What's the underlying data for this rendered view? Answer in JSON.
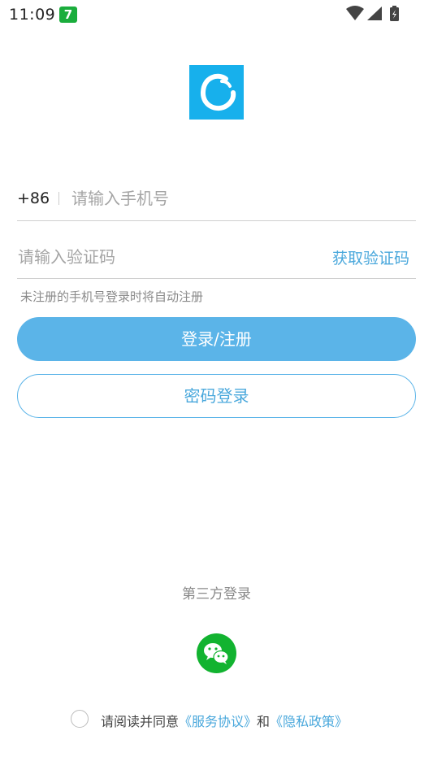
{
  "status_bar": {
    "time": "11:09",
    "notification_badge": "7",
    "icons": [
      "wifi-icon",
      "signal-icon",
      "battery-icon"
    ]
  },
  "logo": {
    "icon": "app-logo-icon",
    "color": "#17b0ec"
  },
  "phone": {
    "country_code": "+86",
    "placeholder": "请输入手机号"
  },
  "code": {
    "placeholder": "请输入验证码",
    "get_code_label": "获取验证码"
  },
  "hint": "未注册的手机号登录时将自动注册",
  "buttons": {
    "login_register": "登录/注册",
    "password_login": "密码登录"
  },
  "third_party": {
    "title": "第三方登录",
    "wechat_icon": "wechat-icon",
    "wechat_color": "#12b330"
  },
  "agreement": {
    "prefix": "请阅读并同意",
    "service": "《服务协议》",
    "and": "和",
    "privacy": "《隐私政策》"
  },
  "colors": {
    "accent": "#5bb4e8",
    "link": "#4aa8dc"
  }
}
